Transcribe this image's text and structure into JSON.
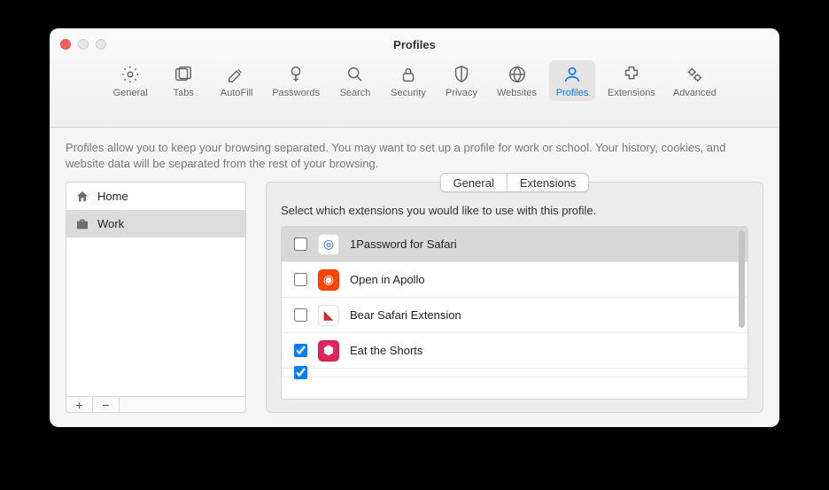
{
  "window": {
    "title": "Profiles"
  },
  "toolbar": [
    {
      "id": "general",
      "label": "General"
    },
    {
      "id": "tabs",
      "label": "Tabs"
    },
    {
      "id": "autofill",
      "label": "AutoFill"
    },
    {
      "id": "passwords",
      "label": "Passwords"
    },
    {
      "id": "search",
      "label": "Search"
    },
    {
      "id": "security",
      "label": "Security"
    },
    {
      "id": "privacy",
      "label": "Privacy"
    },
    {
      "id": "websites",
      "label": "Websites"
    },
    {
      "id": "profiles",
      "label": "Profiles",
      "selected": true
    },
    {
      "id": "extensions",
      "label": "Extensions"
    },
    {
      "id": "advanced",
      "label": "Advanced"
    }
  ],
  "description": "Profiles allow you to keep your browsing separated. You may want to set up a profile for work or school. Your history, cookies, and website data will be separated from the rest of your browsing.",
  "profiles": [
    {
      "name": "Home",
      "icon": "house",
      "selected": false
    },
    {
      "name": "Work",
      "icon": "briefcase",
      "selected": true
    }
  ],
  "segmented": {
    "general": "General",
    "extensions": "Extensions",
    "active": "extensions"
  },
  "instruction": "Select which extensions you would like to use with this profile.",
  "extensions": [
    {
      "name": "1Password for Safari",
      "checked": false,
      "selected": true,
      "icon_bg": "#ffffff",
      "icon_fg": "#1a5fff",
      "glyph": "◎"
    },
    {
      "name": "Open in Apollo",
      "checked": false,
      "selected": false,
      "icon_bg": "#ff4500",
      "icon_fg": "#ffffff",
      "glyph": "◉"
    },
    {
      "name": "Bear Safari Extension",
      "checked": false,
      "selected": false,
      "icon_bg": "#ffffff",
      "icon_fg": "#cc2b2b",
      "glyph": "◣"
    },
    {
      "name": "Eat the Shorts",
      "checked": true,
      "selected": false,
      "icon_bg": "#e0245e",
      "icon_fg": "#ffffff",
      "glyph": "⬢"
    }
  ]
}
